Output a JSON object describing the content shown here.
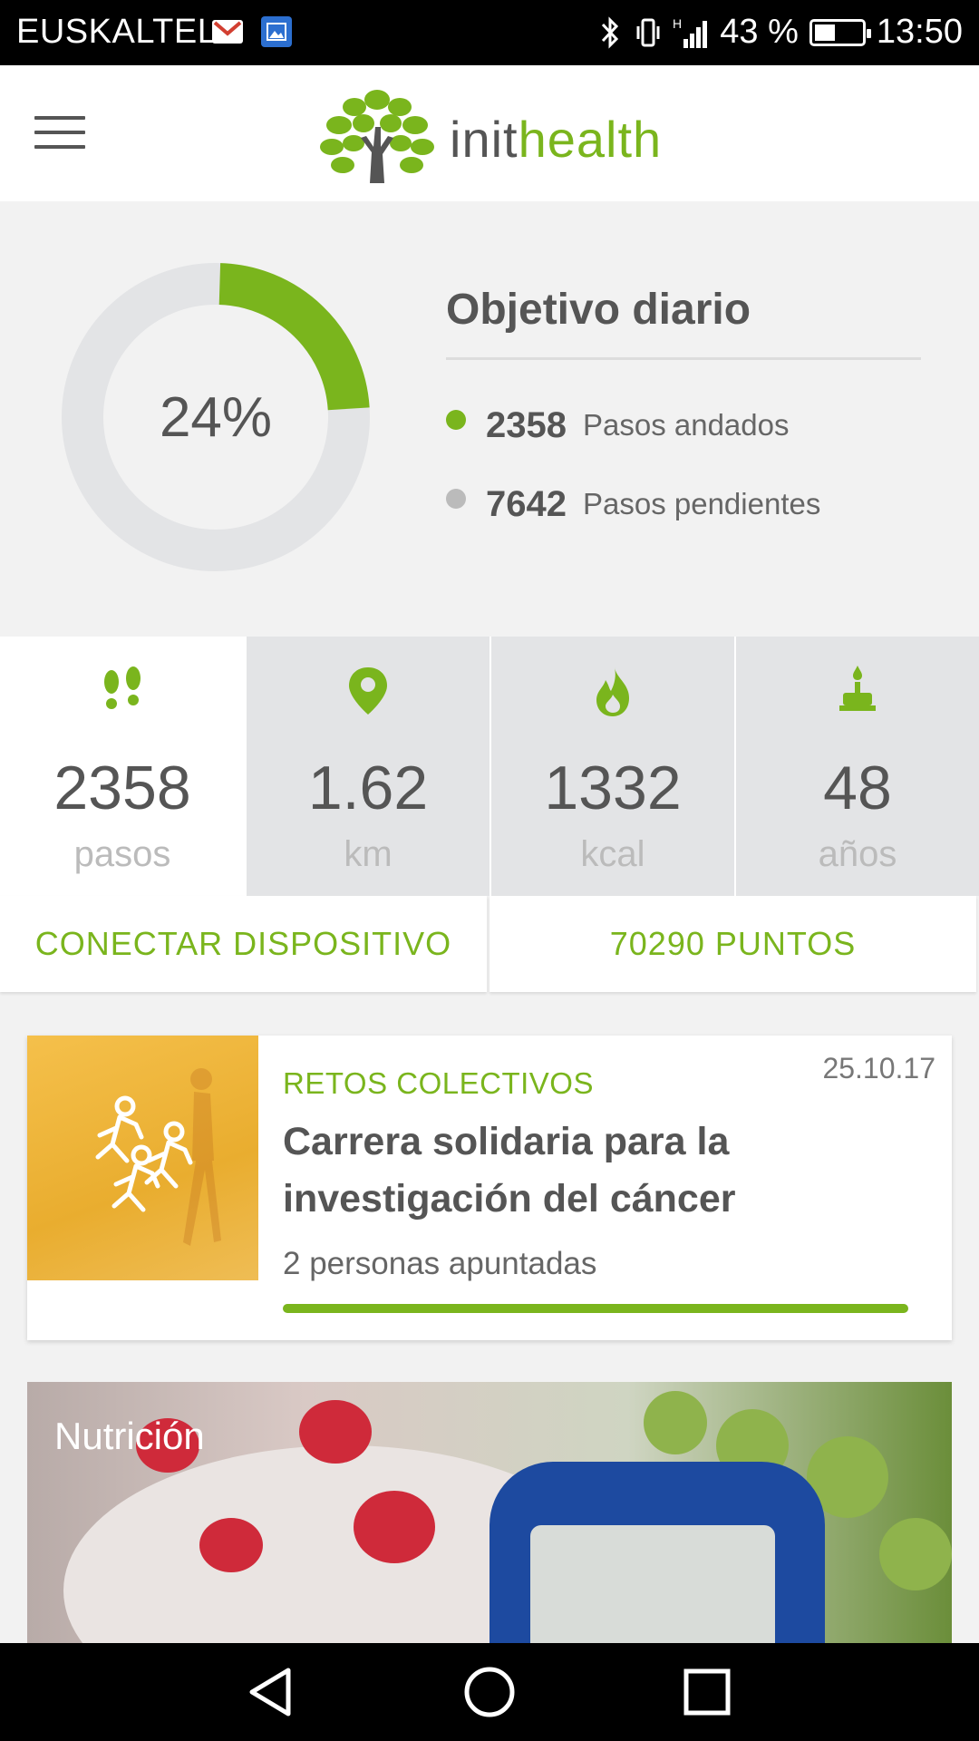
{
  "status_bar": {
    "carrier": "EUSKALTEL",
    "signal_type": "H",
    "battery": "43 %",
    "battery_level": 0.43,
    "time": "13:50",
    "icons": [
      "gmail-icon",
      "gallery-icon",
      "bluetooth-icon",
      "vibrate-icon",
      "signal-icon",
      "battery-icon"
    ]
  },
  "header": {
    "logo_init": "init",
    "logo_health": "health",
    "menu_icon": "hamburger-menu-icon"
  },
  "colors": {
    "accent": "#7ab51d",
    "track": "#e3e4e6",
    "text": "#555555"
  },
  "objective": {
    "percent": 0.24,
    "percent_label": "24%",
    "title": "Objetivo diario",
    "walked_value": "2358",
    "walked_label": "Pasos andados",
    "pending_value": "7642",
    "pending_label": "Pasos pendientes"
  },
  "stats": [
    {
      "icon": "footsteps-icon",
      "value": "2358",
      "unit": "pasos"
    },
    {
      "icon": "location-pin-icon",
      "value": "1.62",
      "unit": "km"
    },
    {
      "icon": "flame-icon",
      "value": "1332",
      "unit": "kcal"
    },
    {
      "icon": "birthday-cake-icon",
      "value": "48",
      "unit": "años"
    }
  ],
  "actions": {
    "connect": "CONECTAR DISPOSITIVO",
    "points": "70290 PUNTOS"
  },
  "challenge": {
    "category": "RETOS COLECTIVOS",
    "date": "25.10.17",
    "title": "Carrera solidaria para la investigación del cáncer",
    "subtitle": "2 personas apuntadas",
    "progress": 1.0,
    "image_icon": "runners-icon"
  },
  "nutrition": {
    "label": "Nutrición"
  },
  "nav": {
    "back": "back-triangle-icon",
    "home": "home-circle-icon",
    "recents": "recents-square-icon"
  }
}
